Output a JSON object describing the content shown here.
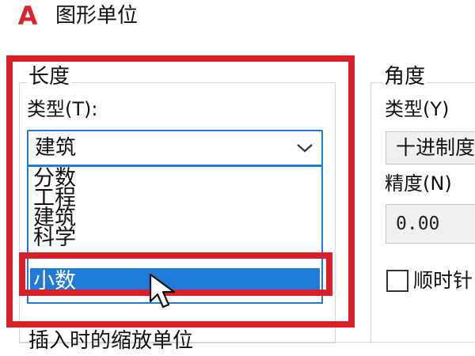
{
  "window": {
    "title": "图形单位",
    "logo_text": "A"
  },
  "length": {
    "section_title": "长度",
    "type_label": "类型(T):",
    "selected_value": "建筑",
    "options": [
      "分数",
      "工程",
      "建筑",
      "科学",
      "小数"
    ],
    "highlighted_option": "小数"
  },
  "angle": {
    "section_title": "角度",
    "type_label": "类型(Y)",
    "type_value": "十进制度",
    "precision_label": "精度(N)",
    "precision_value": "0.00",
    "clockwise_label": "顺时针",
    "clockwise_checked": false
  },
  "insertion": {
    "section_title": "插入时的缩放单位"
  },
  "annotation": {
    "highlight_color": "#d81f2a",
    "selection_color": "#1f7ad8"
  },
  "icons": {
    "logo": "app-logo-icon",
    "dropdown": "chevron-down-icon",
    "cursor": "pointer-icon"
  }
}
